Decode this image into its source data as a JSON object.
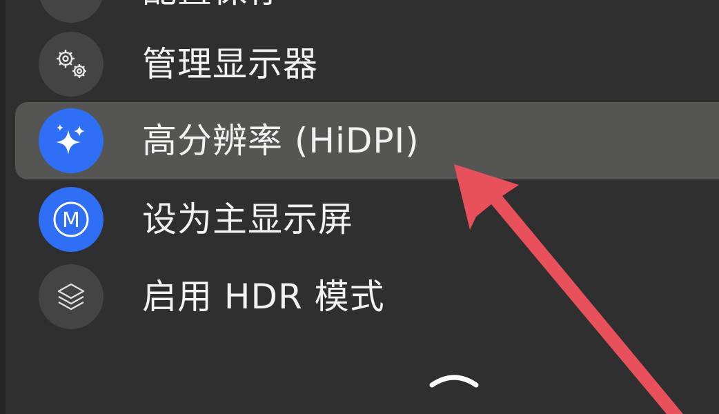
{
  "menu": {
    "items": [
      {
        "label": "配置保存",
        "icon": "cut-off-icon"
      },
      {
        "label": "管理显示器",
        "icon": "gears-icon"
      },
      {
        "label": "高分辨率 (HiDPI)",
        "icon": "sparkles-icon",
        "highlighted": true
      },
      {
        "label": "设为主显示屏",
        "icon": "m-badge-icon"
      },
      {
        "label": "启用 HDR 模式",
        "icon": "layers-icon"
      }
    ],
    "collapse_icon": "chevron-up-icon"
  },
  "colors": {
    "background": "#2f2f2f",
    "highlight": "#555654",
    "accent_blue": "#2f6ff5",
    "annotation_arrow": "#e8505b"
  }
}
